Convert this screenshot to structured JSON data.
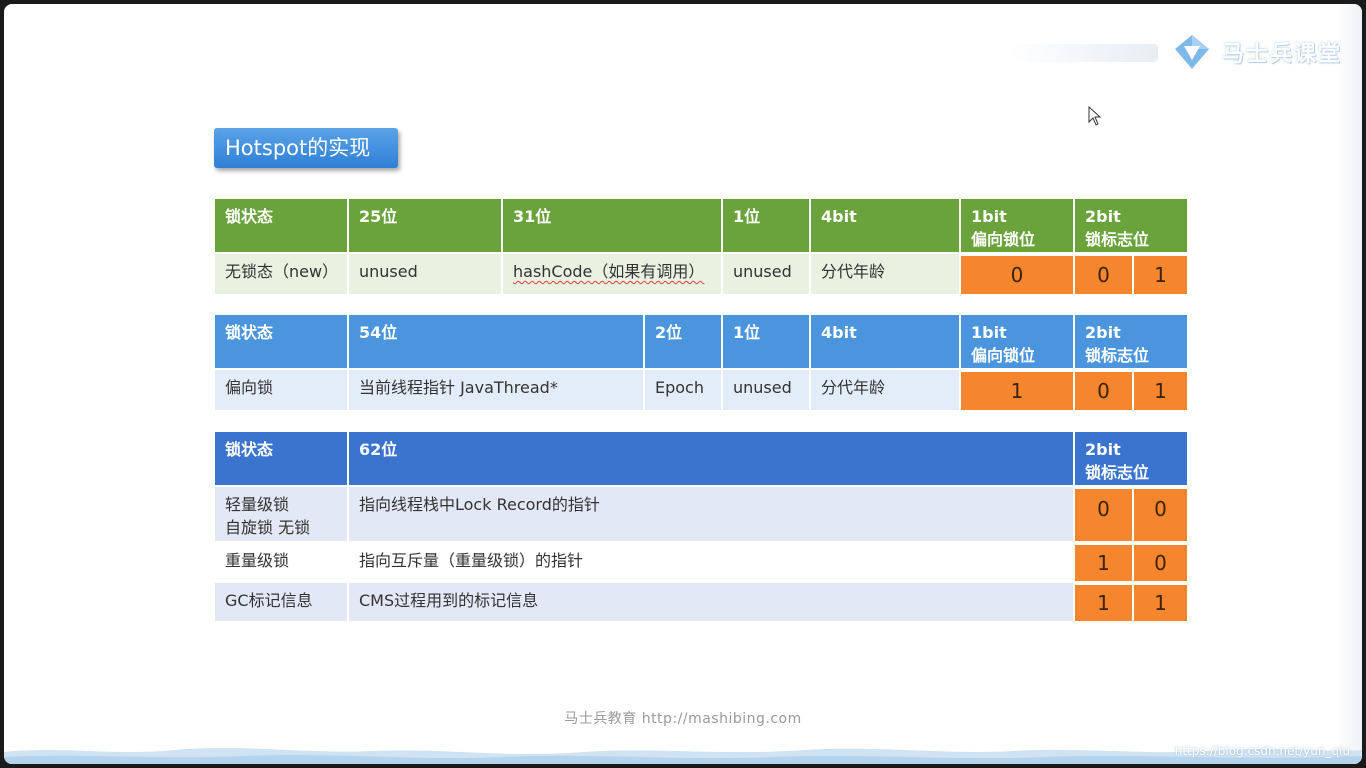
{
  "slide": {
    "brand_text": "马士兵课堂",
    "title": "Hotspot的实现",
    "footer": "马士兵教育 http://mashibing.com",
    "watermark": "https://blog.csdn.net/yun_qiu"
  },
  "colors": {
    "green_header": "#6aa33c",
    "blue_header": "#4b95de",
    "dark_blue_header": "#3b74cf",
    "orange_bit": "#f5862e",
    "title_badge": "#3a88da"
  },
  "table1": {
    "headers": [
      "锁状态",
      "25位",
      "31位",
      "1位",
      "4bit",
      "1bit\n偏向锁位",
      "2bit\n锁标志位"
    ],
    "row": {
      "state": "无锁态（new）",
      "c25": "unused",
      "c31": "hashCode（如果有调用）",
      "c1": "unused",
      "c4": "分代年龄",
      "biased": "0",
      "flag1": "0",
      "flag2": "1"
    }
  },
  "table2": {
    "headers": [
      "锁状态",
      "54位",
      "2位",
      "1位",
      "4bit",
      "1bit\n偏向锁位",
      "2bit\n锁标志位"
    ],
    "row": {
      "state": "偏向锁",
      "c54": "当前线程指针 JavaThread*",
      "c2": "Epoch",
      "c1": "unused",
      "c4": "分代年龄",
      "biased": "1",
      "flag1": "0",
      "flag2": "1"
    }
  },
  "table3": {
    "headers": [
      "锁状态",
      "62位",
      "2bit\n锁标志位"
    ],
    "rows": [
      {
        "state": "轻量级锁\n自旋锁 无锁",
        "content": "指向线程栈中Lock Record的指针",
        "flag1": "0",
        "flag2": "0"
      },
      {
        "state": "重量级锁",
        "content": "指向互斥量（重量级锁）的指针",
        "flag1": "1",
        "flag2": "0"
      },
      {
        "state": "GC标记信息",
        "content": "CMS过程用到的标记信息",
        "flag1": "1",
        "flag2": "1"
      }
    ]
  }
}
